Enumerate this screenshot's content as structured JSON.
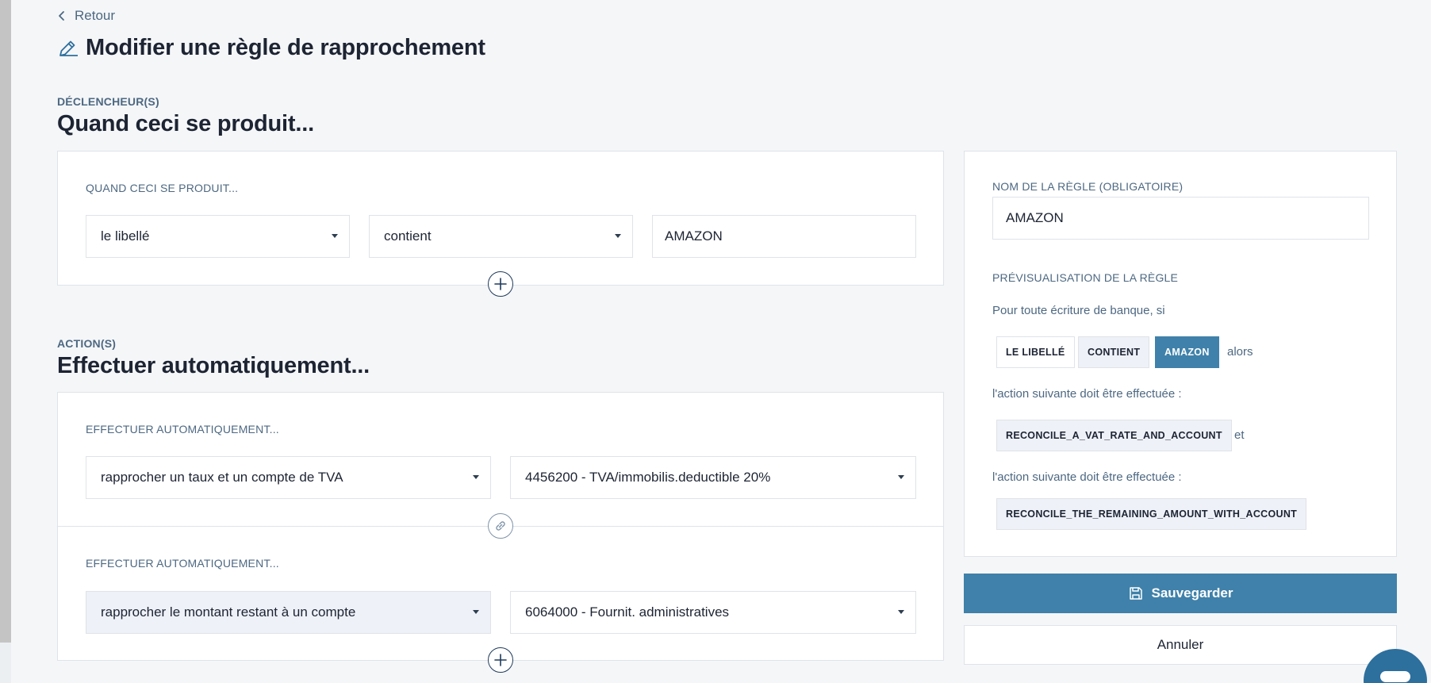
{
  "nav": {
    "back_label": "Retour"
  },
  "page": {
    "title": "Modifier une règle de rapprochement"
  },
  "triggers": {
    "kicker": "DÉCLENCHEUR(S)",
    "title": "Quand ceci se produit...",
    "card_label": "QUAND CECI SE PRODUIT...",
    "field_select": "le libellé",
    "operator_select": "contient",
    "value_input": "AMAZON"
  },
  "actions": {
    "kicker": "ACTION(S)",
    "title": "Effectuer automatiquement...",
    "items": [
      {
        "label": "EFFECTUER AUTOMATIQUEMENT...",
        "action_select": "rapprocher un taux et un compte de TVA",
        "account_select": "4456200 - TVA/immobilis.deductible 20%"
      },
      {
        "label": "EFFECTUER AUTOMATIQUEMENT...",
        "action_select": "rapprocher le montant restant à un compte",
        "account_select": "6064000 - Fournit. administratives"
      }
    ]
  },
  "sidebar": {
    "rule_name_label": "NOM DE LA RÈGLE (OBLIGATOIRE)",
    "rule_name_value": "AMAZON",
    "preview_label": "PRÉVISUALISATION DE LA RÈGLE",
    "preview_intro": "Pour toute écriture de banque, si",
    "chips": [
      "LE LIBELLÉ",
      "CONTIENT",
      "AMAZON"
    ],
    "then_word": "alors",
    "action_sentence_1": "l'action suivante doit être effectuée :",
    "action_chip_1": "RECONCILE_A_VAT_RATE_AND_ACCOUNT",
    "and_word": "et",
    "action_sentence_2": "l'action suivante doit être effectuée :",
    "action_chip_2": "RECONCILE_THE_REMAINING_AMOUNT_WITH_ACCOUNT"
  },
  "buttons": {
    "save": "Sauvegarder",
    "cancel": "Annuler"
  },
  "colors": {
    "accent": "#3f81aa",
    "muted_text": "#4d6882",
    "border": "#dfe3e8"
  },
  "icons": [
    "chevron-left-icon",
    "pencil-icon",
    "plus-circle-icon",
    "link-icon",
    "save-icon",
    "caret-down-icon",
    "chat-icon"
  ]
}
